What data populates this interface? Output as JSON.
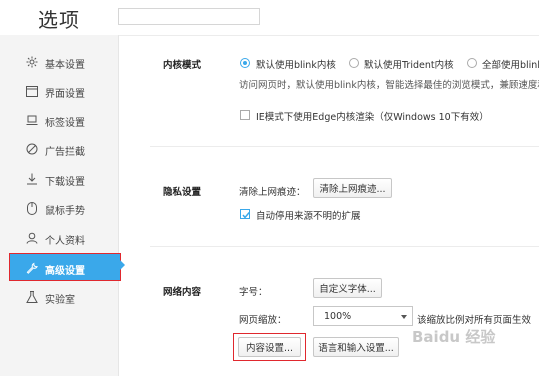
{
  "window": {
    "title": "选项",
    "search_value": ""
  },
  "sidebar": {
    "items": [
      {
        "label": "基本设置"
      },
      {
        "label": "界面设置"
      },
      {
        "label": "标签设置"
      },
      {
        "label": "广告拦截"
      },
      {
        "label": "下载设置"
      },
      {
        "label": "鼠标手势"
      },
      {
        "label": "个人资料"
      },
      {
        "label": "高级设置",
        "active": true
      },
      {
        "label": "实验室"
      }
    ]
  },
  "kernel": {
    "title": "内核模式",
    "options": [
      "默认使用blink内核",
      "默认使用Trident内核",
      "全部使用blink内"
    ],
    "selected": 0,
    "description": "访问网页时，默认使用blink内核，智能选择最佳的浏览模式，兼顾速度和兼",
    "ie_edge_label": "IE模式下使用Edge内核渲染（仅Windows 10下有效）",
    "ie_edge_checked": false
  },
  "privacy": {
    "title": "隐私设置",
    "clear_label": "清除上网痕迹：",
    "clear_button": "清除上网痕迹...",
    "auto_disable_label": "自动停用来源不明的扩展",
    "auto_disable_checked": true
  },
  "web_content": {
    "title": "网络内容",
    "font_label": "字号：",
    "font_button": "自定义字体...",
    "zoom_label": "网页缩放：",
    "zoom_value": "100%",
    "zoom_note": "该缩放比例对所有页面生效",
    "content_settings_button": "内容设置...",
    "language_button": "语言和输入设置..."
  },
  "watermark": "Baidu 经验",
  "colors": {
    "accent": "#3aa8ea",
    "highlight": "#e0282e",
    "sidebar_bg": "#f4f4f4"
  }
}
